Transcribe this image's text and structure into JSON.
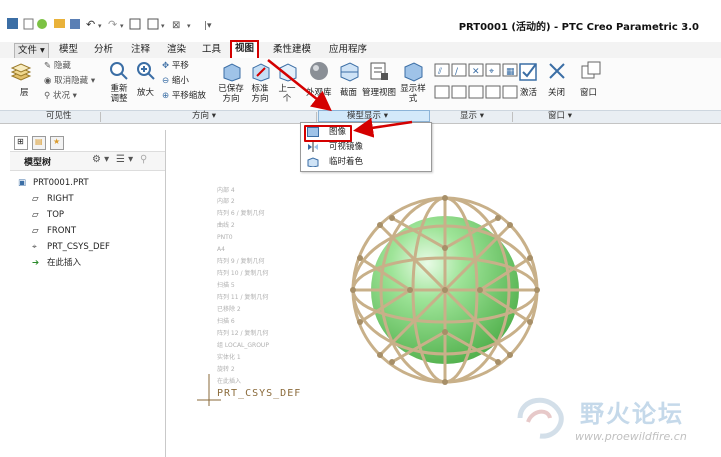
{
  "window": {
    "title": "PRT0001 (活动的) - PTC Creo Parametric 3.0"
  },
  "tabs": [
    {
      "label": "文件"
    },
    {
      "label": "模型"
    },
    {
      "label": "分析"
    },
    {
      "label": "注释"
    },
    {
      "label": "渲染"
    },
    {
      "label": "工具"
    },
    {
      "label": "视图"
    },
    {
      "label": "柔性建模"
    },
    {
      "label": "应用程序"
    }
  ],
  "ribbon": {
    "visibility": {
      "layer": "层",
      "hide": "隐藏",
      "unhide": "取消隐藏",
      "status": "状况"
    },
    "orientation": {
      "refit": "重新\n调整",
      "zoom_in": "放大",
      "pan": "平移",
      "zoom_out": "缩小",
      "pan_zoom": "平移缩放",
      "saved_orient": "已保存\n方向",
      "standard_orient": "标准\n方向",
      "previous": "上一\n个"
    },
    "model_display": {
      "appearance": "外观库",
      "section": "截面",
      "manage_views": "管理视图",
      "display_style": "显示样\n式"
    },
    "window": {
      "activate": "激活",
      "close": "关闭",
      "windows": "窗口"
    },
    "groups": {
      "visibility": "可见性",
      "orientation": "方向",
      "model_display": "模型显示",
      "show": "显示",
      "window": "窗口"
    }
  },
  "dropdown": {
    "items": [
      {
        "label": "图像"
      },
      {
        "label": "可视镜像"
      },
      {
        "label": "临时着色"
      }
    ]
  },
  "model_tree": {
    "header": "模型树",
    "items": [
      {
        "label": "PRT0001.PRT"
      },
      {
        "label": "RIGHT"
      },
      {
        "label": "TOP"
      },
      {
        "label": "FRONT"
      },
      {
        "label": "PRT_CSYS_DEF"
      },
      {
        "label": "在此插入"
      }
    ]
  },
  "graphics": {
    "ghost_tree": [
      "内部 4",
      "内部 2",
      "阵列 6 / 复制几何",
      "曲线 2",
      "PNT0",
      "A4",
      "阵列 9 / 复制几何",
      "阵列 10 / 复制几何",
      "扫描 5",
      "阵列 11 / 复制几何",
      "已移除 2",
      "扫描 6",
      "阵列 12 / 复制几何",
      "组 LOCAL_GROUP",
      "实体化 1",
      "旋转 2",
      "在此插入"
    ],
    "csys_label": "PRT_CSYS_DEF"
  },
  "watermark": {
    "name": "野火论坛",
    "url": "www.proewildfire.cn"
  },
  "colors": {
    "highlight": "#d40000",
    "sphere": "#7fd87a",
    "cage": "#c8b089",
    "accent": "#d3e9fa"
  }
}
